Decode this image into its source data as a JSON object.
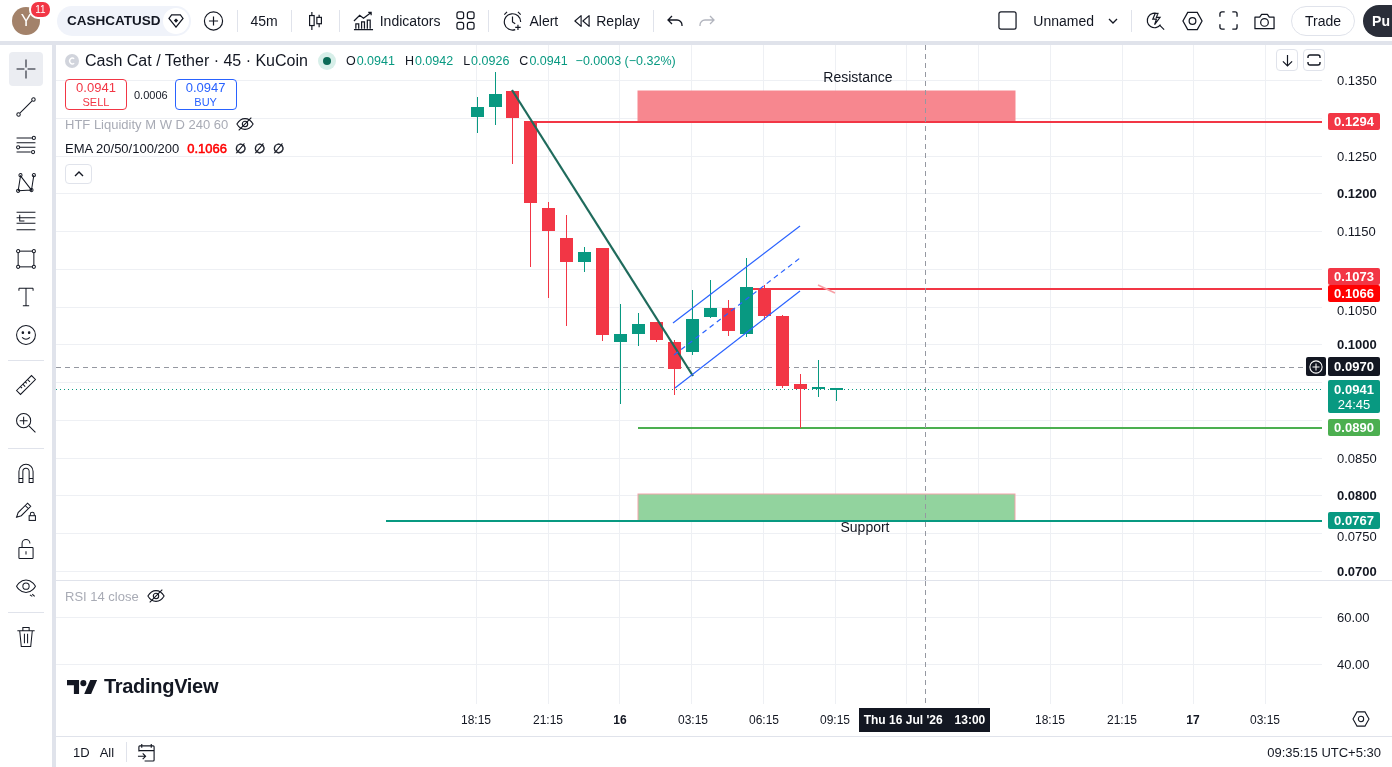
{
  "top_toolbar": {
    "avatar": {
      "letter": "Y",
      "notifications": "11"
    },
    "symbol": "CASHCATUSD",
    "interval": "45m",
    "indicators": "Indicators",
    "alert": "Alert",
    "replay": "Replay",
    "history": [
      {
        "kind": "undo",
        "disabled": false
      },
      {
        "kind": "redo",
        "disabled": true
      }
    ],
    "layout_name": "Unnamed",
    "trade": "Trade",
    "publish": "Pu"
  },
  "tool_groups": [
    {
      "tools": [
        {
          "kind": "crosshair",
          "selected": true
        },
        {
          "kind": "trend-line",
          "selected": false
        },
        {
          "kind": "fib",
          "selected": false
        },
        {
          "kind": "pattern",
          "selected": false
        },
        {
          "kind": "projection",
          "selected": false
        },
        {
          "kind": "rectangle",
          "selected": false
        },
        {
          "kind": "text",
          "selected": false
        },
        {
          "kind": "emoji",
          "selected": false
        }
      ]
    },
    {
      "tools": [
        {
          "kind": "ruler",
          "selected": false
        },
        {
          "kind": "zoom",
          "selected": false
        }
      ]
    },
    {
      "tools": [
        {
          "kind": "magnet",
          "selected": false
        },
        {
          "kind": "lock-drawings",
          "selected": false
        },
        {
          "kind": "lock",
          "selected": false
        },
        {
          "kind": "visibility",
          "selected": false
        }
      ]
    },
    {
      "tools": [
        {
          "kind": "remove",
          "selected": false
        }
      ]
    }
  ],
  "legend": {
    "title": "Cash Cat / Tether · 45 · KuCoin",
    "ohlc": [
      {
        "key": "O",
        "value": "0.0941"
      },
      {
        "key": "H",
        "value": "0.0942"
      },
      {
        "key": "L",
        "value": "0.0926"
      },
      {
        "key": "C",
        "value": "0.0941"
      }
    ],
    "change": "−0.0003 (−0.32%)",
    "sell": {
      "price": "0.0941",
      "label": "SELL"
    },
    "spread": "0.0006",
    "buy": {
      "price": "0.0947",
      "label": "BUY"
    },
    "indicators": [
      {
        "name": "HTF Liquidity M W D 240 60",
        "hidden": true
      },
      {
        "name": "EMA 20/50/100/200",
        "hidden": false,
        "values": [
          {
            "text": "0.1066",
            "color": "#ff0000"
          },
          {
            "text": "∅",
            "color": "#131722"
          },
          {
            "text": "∅",
            "color": "#131722"
          },
          {
            "text": "∅",
            "color": "#131722"
          }
        ]
      }
    ]
  },
  "drawings": [
    {
      "kind": "resistance",
      "label": "Resistance"
    },
    {
      "kind": "support",
      "label": "Support"
    }
  ],
  "price_axis": {
    "ticks": [
      {
        "text": "0.1350",
        "major": false
      },
      {
        "text": "0.1250",
        "major": false
      },
      {
        "text": "0.1200",
        "major": true
      },
      {
        "text": "0.1150",
        "major": false
      },
      {
        "text": "0.1050",
        "major": false
      },
      {
        "text": "0.1000",
        "major": true
      },
      {
        "text": "0.0850",
        "major": false
      },
      {
        "text": "0.0800",
        "major": true
      },
      {
        "text": "0.0750",
        "major": false
      },
      {
        "text": "0.0700",
        "major": true
      }
    ],
    "labels": [
      {
        "kind": "level",
        "text": "0.1294",
        "color": "#f23645"
      },
      {
        "kind": "level",
        "text": "0.1073",
        "color": "#f23645"
      },
      {
        "kind": "indicator",
        "text": "0.1066",
        "color": "#ff0000"
      },
      {
        "kind": "crosshair",
        "text": "0.0970",
        "color": "#131722"
      },
      {
        "kind": "last-price",
        "text": "0.0941",
        "countdown": "24:45",
        "color": "#089981"
      },
      {
        "kind": "level",
        "text": "0.0890",
        "color": "#4caf50"
      },
      {
        "kind": "level",
        "text": "0.0767",
        "color": "#089981"
      }
    ]
  },
  "rsi_pane": {
    "name": "RSI 14 close",
    "hidden": true,
    "ticks": [
      "60.00",
      "40.00"
    ]
  },
  "logo": "TradingView",
  "time_axis": {
    "labels": [
      {
        "text": "18:15",
        "major": false
      },
      {
        "text": "21:15",
        "major": false
      },
      {
        "text": "16",
        "major": true
      },
      {
        "text": "03:15",
        "major": false
      },
      {
        "text": "06:15",
        "major": false
      },
      {
        "text": "09:15",
        "major": false
      },
      {
        "text": "18:15",
        "major": false
      },
      {
        "text": "21:15",
        "major": false
      },
      {
        "text": "17",
        "major": true
      },
      {
        "text": "03:15",
        "major": false
      }
    ],
    "crosshair": {
      "date": "Thu 16 Jul '26",
      "time": "13:00"
    }
  },
  "bottom_bar": {
    "ranges": [
      "1D",
      "All"
    ],
    "clock": "09:35:15 UTC+5:30"
  }
}
